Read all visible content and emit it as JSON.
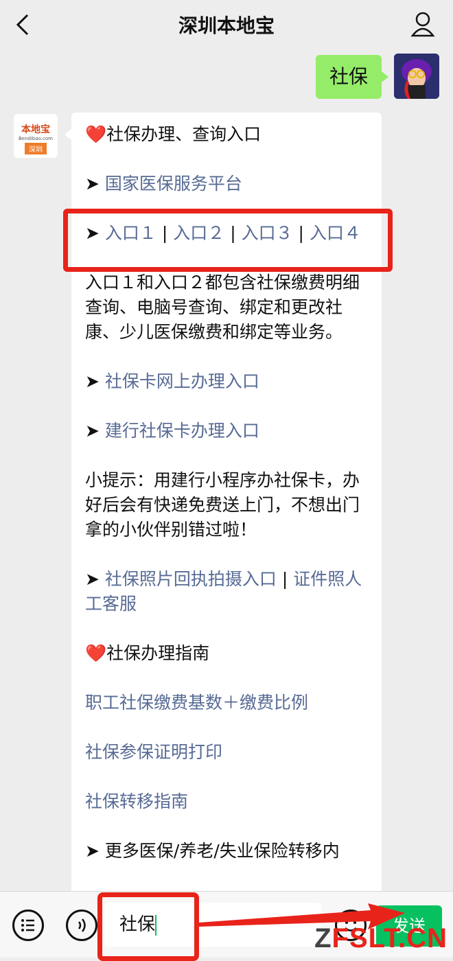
{
  "header": {
    "title": "深圳本地宝",
    "back_icon": "chevron-left-icon",
    "profile_icon": "user-icon"
  },
  "user_message": {
    "text": "社保"
  },
  "bot_avatar": {
    "brand": "本地宝",
    "site": "Bendibao.com",
    "city": "深圳"
  },
  "bot_message": {
    "heading1": "❤️社保办理、查询入口",
    "arrow": "➤",
    "link_national": "国家医保服务平台",
    "entry1": "入口１",
    "entry2": "入口２",
    "entry3": "入口３",
    "entry4": "入口４",
    "separator": " | ",
    "desc": "入口１和入口２都包含社保缴费明细查询、电脑号查询、绑定和更改社康、少儿医保缴费和绑定等业务。",
    "link_card_online": "社保卡网上办理入口",
    "link_ccb_card": "建行社保卡办理入口",
    "tip": "小提示：用建行小程序办社保卡，办好后会有快递免费送上门，不想出门拿的小伙伴别错过啦！",
    "link_photo": "社保照片回执拍摄入口",
    "link_photo_service": "证件照人工客服",
    "heading2": "❤️社保办理指南",
    "link_base": "职工社保缴费基数＋缴费比例",
    "link_proof": "社保参保证明打印",
    "link_transfer": "社保转移指南",
    "more_prefix": "更多医保/养老/失业保险转移内"
  },
  "input_bar": {
    "menu_icon": "menu-list-icon",
    "voice_icon": "voice-icon",
    "emoji_icon": "emoji-icon",
    "input_value": "社保",
    "send_label": "发送"
  },
  "watermark": {
    "text": "FSLT.CN"
  },
  "colors": {
    "link": "#576b95",
    "my_bubble": "#95ec69",
    "send": "#07c160",
    "highlight": "#e8231a"
  }
}
